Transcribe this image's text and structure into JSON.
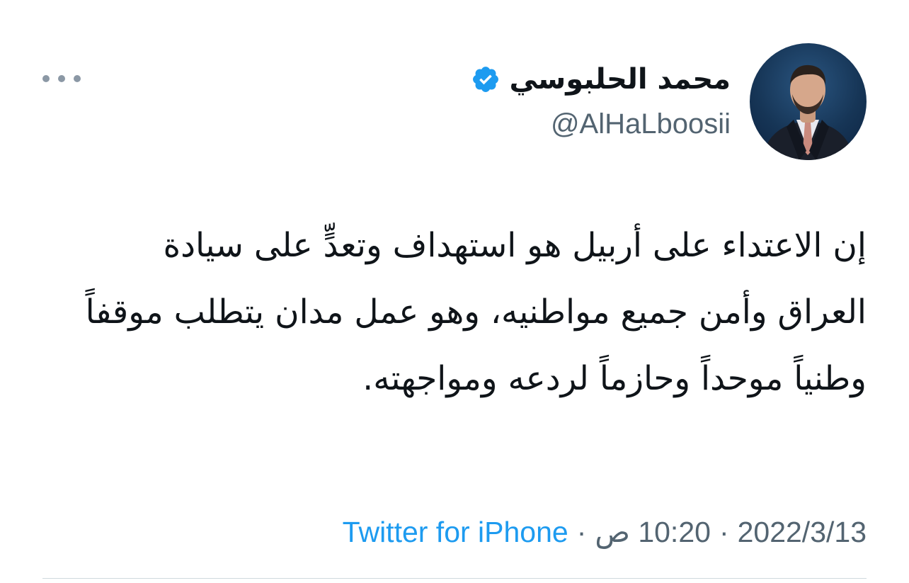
{
  "author": {
    "display_name": "محمد الحلبوسي",
    "handle": "@AlHaLboosii",
    "verified_icon": "verified-badge-icon",
    "avatar_icon": "profile-photo"
  },
  "actions": {
    "more_icon": "more-options-icon"
  },
  "tweet": {
    "text": "إن الاعتداء على أربيل هو استهداف وتعدٍّ على سيادة العراق وأمن جميع مواطنيه، وهو عمل مدان يتطلب موقفاً وطنياً موحداً وحازماً لردعه ومواجهته."
  },
  "meta": {
    "date": "2022/3/13",
    "time": "10:20 ص",
    "separator": "·",
    "source": "Twitter for iPhone"
  },
  "colors": {
    "text": "#0f1419",
    "secondary": "#536471",
    "link": "#1d9bf0",
    "verified": "#1d9bf0",
    "divider": "#cfd9de"
  }
}
